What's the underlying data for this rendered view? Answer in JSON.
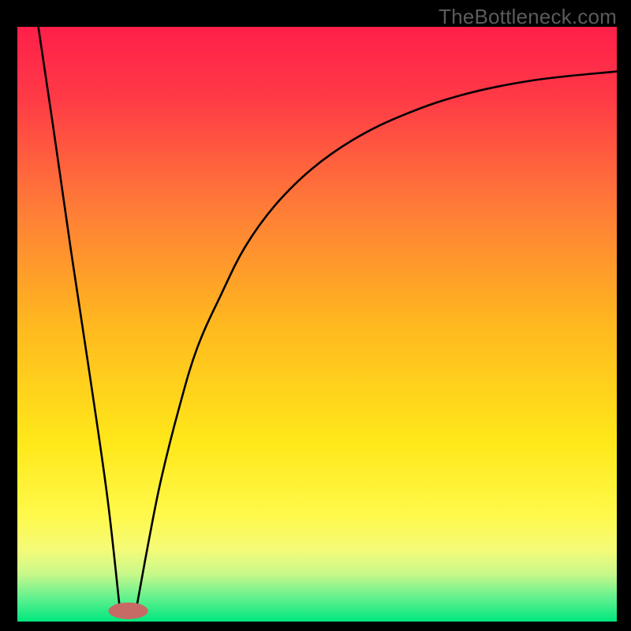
{
  "watermark": "TheBottleneck.com",
  "chart_data": {
    "type": "line",
    "title": "",
    "xlabel": "",
    "ylabel": "",
    "xlim": [
      0,
      100
    ],
    "ylim": [
      0,
      100
    ],
    "grid": false,
    "legend": false,
    "background_gradient": {
      "stops": [
        {
          "offset": 0.0,
          "color": "#ff1f4a"
        },
        {
          "offset": 0.12,
          "color": "#ff3a46"
        },
        {
          "offset": 0.3,
          "color": "#ff7a38"
        },
        {
          "offset": 0.5,
          "color": "#ffb81f"
        },
        {
          "offset": 0.7,
          "color": "#ffe81a"
        },
        {
          "offset": 0.82,
          "color": "#fff94a"
        },
        {
          "offset": 0.88,
          "color": "#f4fb78"
        },
        {
          "offset": 0.92,
          "color": "#c8f88a"
        },
        {
          "offset": 0.96,
          "color": "#62f18f"
        },
        {
          "offset": 1.0,
          "color": "#00e77e"
        }
      ]
    },
    "series": [
      {
        "name": "left-branch",
        "x": [
          3.5,
          6,
          9,
          12,
          15,
          17
        ],
        "y": [
          100,
          83,
          62,
          42,
          21,
          3
        ]
      },
      {
        "name": "right-branch",
        "x": [
          20,
          22,
          24,
          27,
          30,
          34,
          38,
          43,
          49,
          56,
          64,
          74,
          86,
          100
        ],
        "y": [
          3,
          14,
          24,
          36,
          46,
          55,
          63,
          70,
          76,
          81,
          85,
          88.5,
          91,
          92.5
        ]
      }
    ],
    "marker": {
      "name": "minimum-marker",
      "cx": 18.5,
      "cy": 1.8,
      "rx": 3.3,
      "ry": 1.4,
      "fill": "#c76a66"
    }
  }
}
